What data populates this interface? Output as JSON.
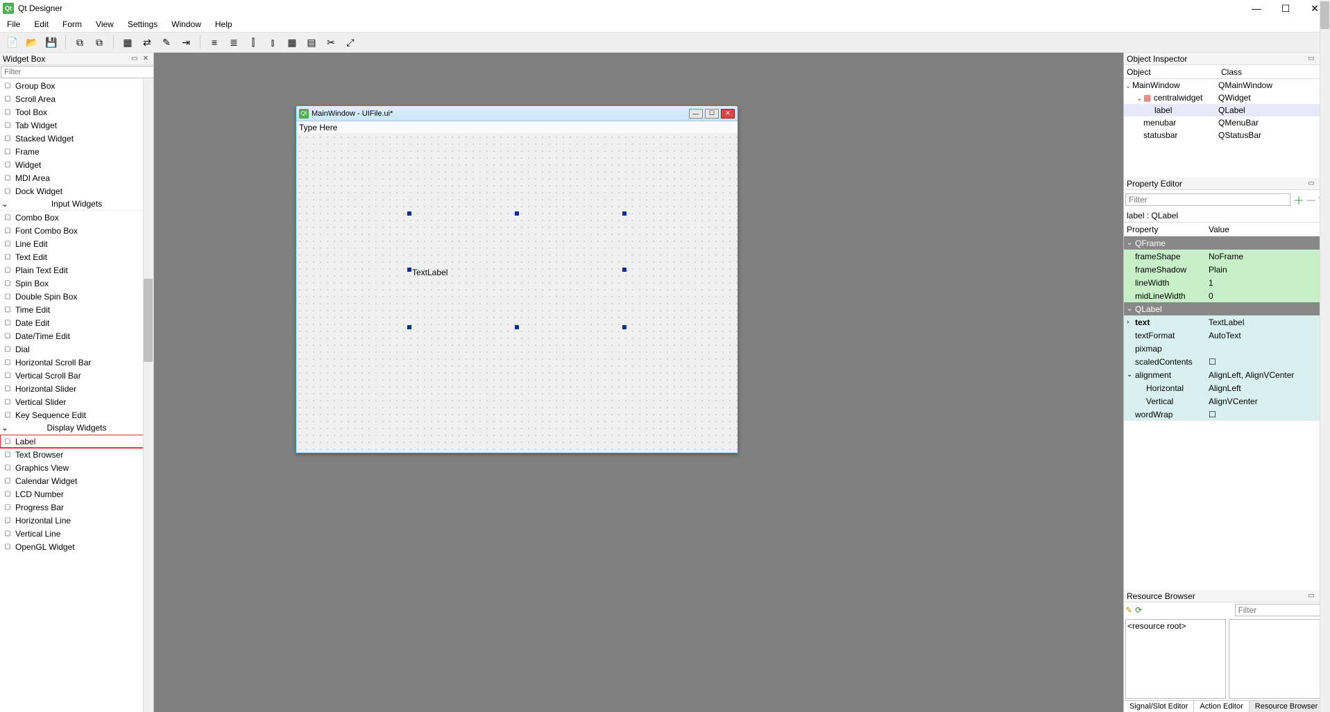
{
  "app": {
    "title": "Qt Designer"
  },
  "menus": [
    "File",
    "Edit",
    "Form",
    "View",
    "Settings",
    "Window",
    "Help"
  ],
  "widgetbox": {
    "title": "Widget Box",
    "filter_placeholder": "Filter",
    "items": [
      {
        "type": "item",
        "label": "Group Box"
      },
      {
        "type": "item",
        "label": "Scroll Area"
      },
      {
        "type": "item",
        "label": "Tool Box"
      },
      {
        "type": "item",
        "label": "Tab Widget"
      },
      {
        "type": "item",
        "label": "Stacked Widget"
      },
      {
        "type": "item",
        "label": "Frame"
      },
      {
        "type": "item",
        "label": "Widget"
      },
      {
        "type": "item",
        "label": "MDI Area"
      },
      {
        "type": "item",
        "label": "Dock Widget"
      },
      {
        "type": "cat",
        "label": "Input Widgets"
      },
      {
        "type": "item",
        "label": "Combo Box"
      },
      {
        "type": "item",
        "label": "Font Combo Box"
      },
      {
        "type": "item",
        "label": "Line Edit"
      },
      {
        "type": "item",
        "label": "Text Edit"
      },
      {
        "type": "item",
        "label": "Plain Text Edit"
      },
      {
        "type": "item",
        "label": "Spin Box"
      },
      {
        "type": "item",
        "label": "Double Spin Box"
      },
      {
        "type": "item",
        "label": "Time Edit"
      },
      {
        "type": "item",
        "label": "Date Edit"
      },
      {
        "type": "item",
        "label": "Date/Time Edit"
      },
      {
        "type": "item",
        "label": "Dial"
      },
      {
        "type": "item",
        "label": "Horizontal Scroll Bar"
      },
      {
        "type": "item",
        "label": "Vertical Scroll Bar"
      },
      {
        "type": "item",
        "label": "Horizontal Slider"
      },
      {
        "type": "item",
        "label": "Vertical Slider"
      },
      {
        "type": "item",
        "label": "Key Sequence Edit"
      },
      {
        "type": "cat",
        "label": "Display Widgets"
      },
      {
        "type": "item",
        "label": "Label",
        "highlight": true
      },
      {
        "type": "item",
        "label": "Text Browser"
      },
      {
        "type": "item",
        "label": "Graphics View"
      },
      {
        "type": "item",
        "label": "Calendar Widget"
      },
      {
        "type": "item",
        "label": "LCD Number"
      },
      {
        "type": "item",
        "label": "Progress Bar"
      },
      {
        "type": "item",
        "label": "Horizontal Line"
      },
      {
        "type": "item",
        "label": "Vertical Line"
      },
      {
        "type": "item",
        "label": "OpenGL Widget"
      }
    ]
  },
  "form": {
    "title": "MainWindow - UIFile.ui*",
    "menu_placeholder": "Type Here",
    "label_text": "TextLabel"
  },
  "object_inspector": {
    "title": "Object Inspector",
    "columns": [
      "Object",
      "Class"
    ],
    "rows": [
      {
        "indent": 0,
        "exp": "v",
        "obj": "MainWindow",
        "cls": "QMainWindow"
      },
      {
        "indent": 1,
        "exp": "v",
        "obj": "centralwidget",
        "cls": "QWidget",
        "icon": true
      },
      {
        "indent": 2,
        "exp": "",
        "obj": "label",
        "cls": "QLabel",
        "sel": true
      },
      {
        "indent": 1,
        "exp": "",
        "obj": "menubar",
        "cls": "QMenuBar"
      },
      {
        "indent": 1,
        "exp": "",
        "obj": "statusbar",
        "cls": "QStatusBar"
      }
    ]
  },
  "property_editor": {
    "title": "Property Editor",
    "filter_placeholder": "Filter",
    "info": "label : QLabel",
    "columns": [
      "Property",
      "Value"
    ],
    "rows": [
      {
        "kind": "head",
        "name": "QFrame"
      },
      {
        "kind": "qframe",
        "name": "frameShape",
        "val": "NoFrame"
      },
      {
        "kind": "qframe",
        "name": "frameShadow",
        "val": "Plain"
      },
      {
        "kind": "qframe",
        "name": "lineWidth",
        "val": "1"
      },
      {
        "kind": "qframe",
        "name": "midLineWidth",
        "val": "0"
      },
      {
        "kind": "qlabel-h",
        "name": "QLabel"
      },
      {
        "kind": "qlabel",
        "exp": ">",
        "name": "text",
        "val": "TextLabel",
        "bold": true
      },
      {
        "kind": "qlabel",
        "name": "textFormat",
        "val": "AutoText"
      },
      {
        "kind": "qlabel",
        "name": "pixmap",
        "val": ""
      },
      {
        "kind": "qlabel",
        "name": "scaledContents",
        "val": "☐"
      },
      {
        "kind": "qlabel",
        "exp": "v",
        "name": "alignment",
        "val": "AlignLeft, AlignVCenter"
      },
      {
        "kind": "qlabel",
        "indent": true,
        "name": "Horizontal",
        "val": "AlignLeft"
      },
      {
        "kind": "qlabel",
        "indent": true,
        "name": "Vertical",
        "val": "AlignVCenter"
      },
      {
        "kind": "qlabel",
        "name": "wordWrap",
        "val": "☐"
      }
    ]
  },
  "resource_browser": {
    "title": "Resource Browser",
    "filter_placeholder": "Filter",
    "root": "<resource root>",
    "tabs": [
      "Signal/Slot Editor",
      "Action Editor",
      "Resource Browser"
    ]
  }
}
